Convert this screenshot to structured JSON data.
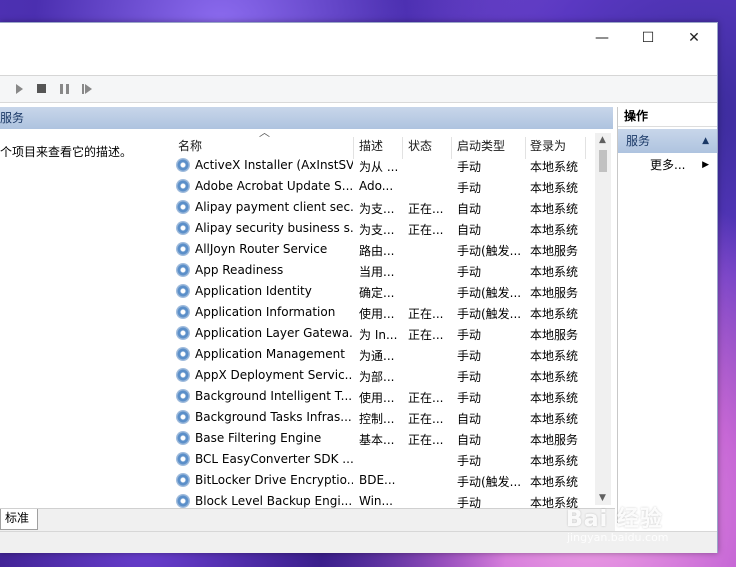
{
  "window": {
    "controls": {
      "minimize": "—",
      "maximize": "☐",
      "close": "✕"
    }
  },
  "main": {
    "pane_title": "服务",
    "description_hint": "个项目来查看它的描述。",
    "columns": [
      "名称",
      "描述",
      "状态",
      "启动类型",
      "登录为"
    ],
    "services": [
      {
        "name": "ActiveX Installer (AxInstSV)",
        "desc": "为从 ...",
        "state": "",
        "startup": "手动",
        "logon": "本地系统"
      },
      {
        "name": "Adobe Acrobat Update S...",
        "desc": "Ado...",
        "state": "",
        "startup": "手动",
        "logon": "本地系统"
      },
      {
        "name": "Alipay payment client sec...",
        "desc": "为支...",
        "state": "正在...",
        "startup": "自动",
        "logon": "本地系统"
      },
      {
        "name": "Alipay security business s...",
        "desc": "为支...",
        "state": "正在...",
        "startup": "自动",
        "logon": "本地系统"
      },
      {
        "name": "AllJoyn Router Service",
        "desc": "路由...",
        "state": "",
        "startup": "手动(触发...",
        "logon": "本地服务"
      },
      {
        "name": "App Readiness",
        "desc": "当用...",
        "state": "",
        "startup": "手动",
        "logon": "本地系统"
      },
      {
        "name": "Application Identity",
        "desc": "确定...",
        "state": "",
        "startup": "手动(触发...",
        "logon": "本地服务"
      },
      {
        "name": "Application Information",
        "desc": "使用...",
        "state": "正在...",
        "startup": "手动(触发...",
        "logon": "本地系统"
      },
      {
        "name": "Application Layer Gatewa...",
        "desc": "为 In...",
        "state": "正在...",
        "startup": "手动",
        "logon": "本地服务"
      },
      {
        "name": "Application Management",
        "desc": "为通...",
        "state": "",
        "startup": "手动",
        "logon": "本地系统"
      },
      {
        "name": "AppX Deployment Servic...",
        "desc": "为部...",
        "state": "",
        "startup": "手动",
        "logon": "本地系统"
      },
      {
        "name": "Background Intelligent T...",
        "desc": "使用...",
        "state": "正在...",
        "startup": "手动",
        "logon": "本地系统"
      },
      {
        "name": "Background Tasks Infras...",
        "desc": "控制...",
        "state": "正在...",
        "startup": "自动",
        "logon": "本地系统"
      },
      {
        "name": "Base Filtering Engine",
        "desc": "基本...",
        "state": "正在...",
        "startup": "自动",
        "logon": "本地服务"
      },
      {
        "name": "BCL EasyConverter SDK ...",
        "desc": "",
        "state": "",
        "startup": "手动",
        "logon": "本地系统"
      },
      {
        "name": "BitLocker Drive Encryptio...",
        "desc": "BDE...",
        "state": "",
        "startup": "手动(触发...",
        "logon": "本地系统"
      },
      {
        "name": "Block Level Backup Engi...",
        "desc": "Win...",
        "state": "",
        "startup": "手动",
        "logon": "本地系统"
      }
    ]
  },
  "actions": {
    "header": "操作",
    "group": "服务",
    "more": "更多..."
  },
  "tabs": [
    "标准"
  ],
  "watermark": {
    "logo": "Bai 经验",
    "url": "jingyan.baidu.com"
  }
}
